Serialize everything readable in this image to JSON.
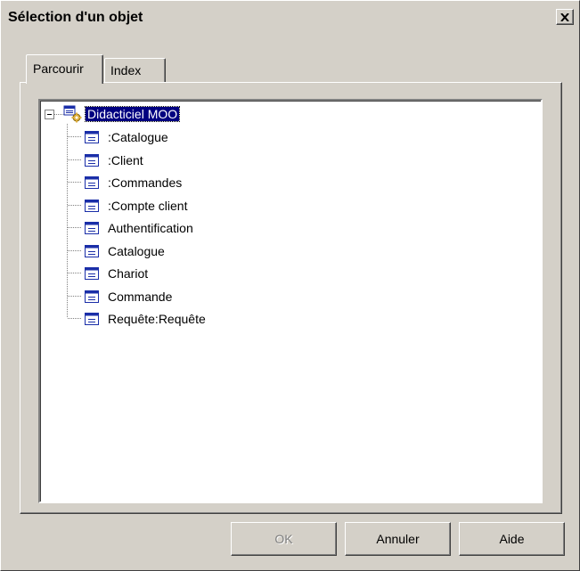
{
  "window": {
    "title": "Sélection d'un objet"
  },
  "tabs": [
    {
      "label": "Parcourir",
      "active": true
    },
    {
      "label": "Index",
      "active": false
    }
  ],
  "tree": {
    "root": {
      "label": "Didacticiel MOO",
      "icon": "model-icon",
      "expanded": true
    },
    "children": [
      {
        "label": ":Catalogue",
        "icon": "class-icon"
      },
      {
        "label": ":Client",
        "icon": "class-icon"
      },
      {
        "label": ":Commandes",
        "icon": "class-icon"
      },
      {
        "label": ":Compte client",
        "icon": "class-icon"
      },
      {
        "label": "Authentification",
        "icon": "class-icon"
      },
      {
        "label": "Catalogue",
        "icon": "class-icon"
      },
      {
        "label": "Chariot",
        "icon": "class-icon"
      },
      {
        "label": "Commande",
        "icon": "class-icon"
      },
      {
        "label": "Requête:Requête",
        "icon": "class-icon"
      }
    ]
  },
  "buttons": {
    "ok": "OK",
    "cancel": "Annuler",
    "help": "Aide"
  },
  "colors": {
    "face": "#d4d0c8",
    "selection": "#000080",
    "icon": "#1a2ea8"
  }
}
